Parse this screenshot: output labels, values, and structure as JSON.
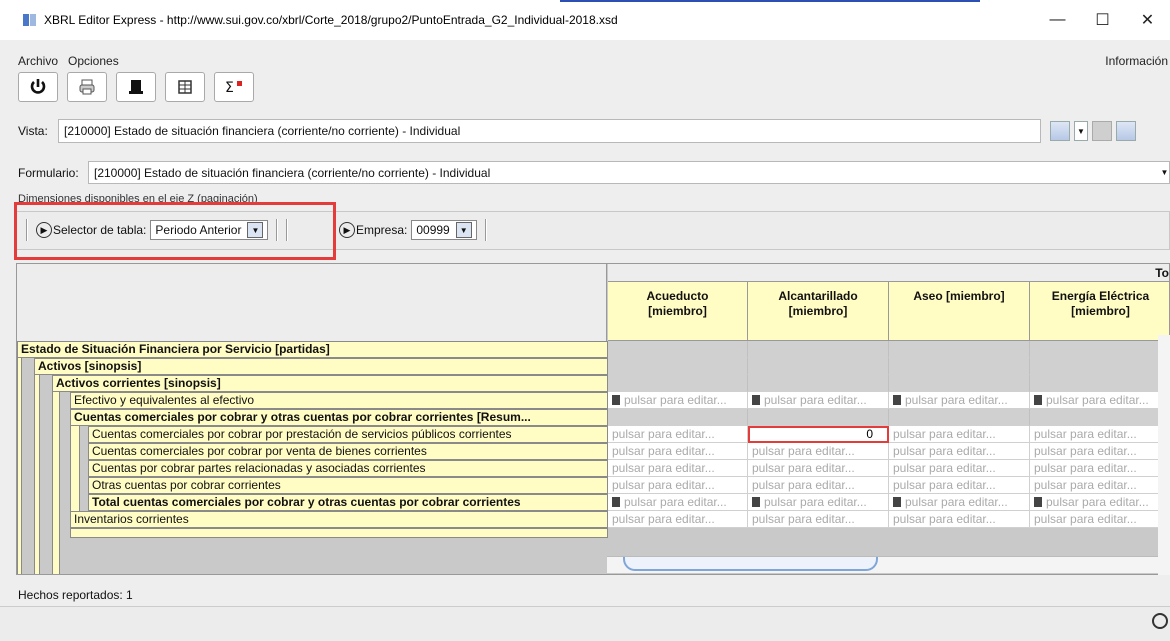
{
  "window": {
    "title": "XBRL Editor Express - http://www.sui.gov.co/xbrl/Corte_2018/grupo2/PuntoEntrada_G2_Individual-2018.xsd",
    "minimize": "—",
    "maximize": "☐",
    "close": "✕"
  },
  "menu": {
    "archivo": "Archivo",
    "opciones": "Opciones",
    "informacion": "Información"
  },
  "vista": {
    "label": "Vista:",
    "value": "[210000] Estado de situación financiera (corriente/no corriente) - Individual"
  },
  "formulario": {
    "label": "Formulario:",
    "value": "[210000] Estado de situación financiera (corriente/no corriente) - Individual"
  },
  "dimensions": {
    "label": "Dimensiones disponibles en el eje Z (paginación)",
    "selector_label": "Selector de tabla:",
    "selector_value": "Periodo Anterior",
    "empresa_label": "Empresa:",
    "empresa_value": "00999"
  },
  "table": {
    "top_header": "To",
    "columns": [
      {
        "line1": "Acueducto",
        "line2": "[miembro]"
      },
      {
        "line1": "Alcantarillado",
        "line2": "[miembro]"
      },
      {
        "line1": "Aseo [miembro]",
        "line2": ""
      },
      {
        "line1": "Energía Eléctrica",
        "line2": "[miembro]"
      }
    ],
    "placeholder": "pulsar para editar...",
    "edit_value": "0",
    "rows": [
      {
        "label": "Estado de Situación Financiera por Servicio [partidas]"
      },
      {
        "label": "Activos [sinopsis]"
      },
      {
        "label": "Activos corrientes [sinopsis]"
      },
      {
        "label": "Efectivo y equivalentes al efectivo"
      },
      {
        "label": "Cuentas comerciales por cobrar y otras cuentas por cobrar corrientes [Resum..."
      },
      {
        "label": "Cuentas comerciales por cobrar por prestación de servicios públicos corrientes"
      },
      {
        "label": "Cuentas comerciales por cobrar por venta de bienes corrientes"
      },
      {
        "label": "Cuentas por cobrar partes relacionadas y asociadas corrientes"
      },
      {
        "label": "Otras cuentas por cobrar corrientes"
      },
      {
        "label": "Total cuentas comerciales por cobrar y otras cuentas por cobrar corrientes"
      },
      {
        "label": "Inventarios corrientes"
      }
    ]
  },
  "status": {
    "text": "Hechos reportados: 1"
  }
}
